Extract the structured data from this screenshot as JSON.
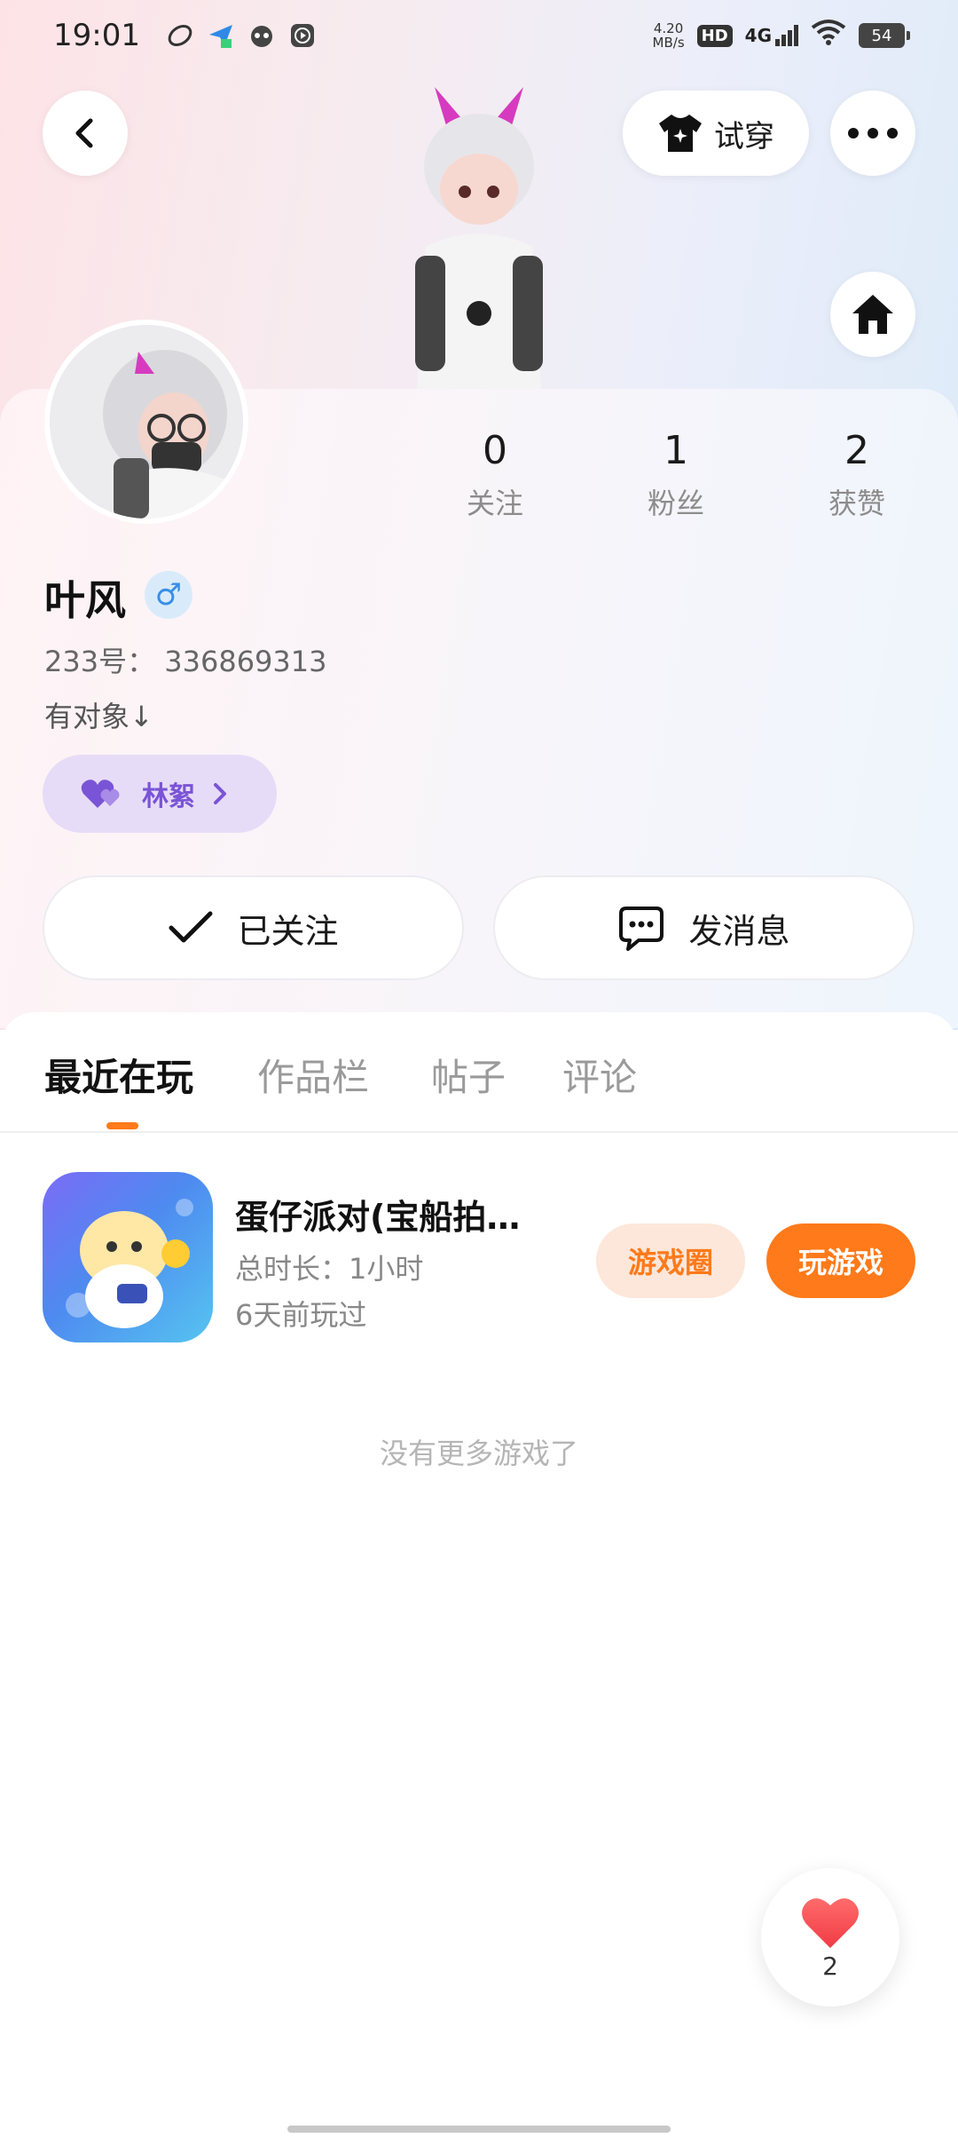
{
  "status_bar": {
    "time": "19:01",
    "net_speed_value": "4.20",
    "net_speed_unit": "MB/s",
    "hd": "HD",
    "network": "4G",
    "battery": "54"
  },
  "header": {
    "tryon_label": "试穿"
  },
  "profile": {
    "following_count": "0",
    "following_label": "关注",
    "fans_count": "1",
    "fans_label": "粉丝",
    "likes_count": "2",
    "likes_label": "获赞",
    "nickname": "叶风",
    "gender_symbol": "♂",
    "id_text": "233号： 336869313",
    "bio": "有对象↓",
    "partner_name": "林絮"
  },
  "actions": {
    "followed_label": "已关注",
    "message_label": "发消息"
  },
  "tabs": [
    {
      "label": "最近在玩"
    },
    {
      "label": "作品栏"
    },
    {
      "label": "帖子"
    },
    {
      "label": "评论"
    }
  ],
  "games": [
    {
      "title": "蛋仔派对(宝船拍…",
      "duration": "总时长：1小时",
      "last_played": "6天前玩过",
      "circle_label": "游戏圈",
      "play_label": "玩游戏"
    }
  ],
  "footer": {
    "no_more_text": "没有更多游戏了",
    "like_count": "2"
  },
  "colors": {
    "accent": "#ff7a1a",
    "partner_purple": "#7a54d6",
    "partner_bg": "#e7dcf7",
    "gender_blue": "#3a8ee6"
  },
  "icons": {
    "back": "chevron-left-icon",
    "tryon": "tshirt-icon",
    "more": "more-dots-icon",
    "home": "home-icon",
    "check": "check-icon",
    "chat": "chat-bubble-icon",
    "heart": "heart-icon"
  }
}
